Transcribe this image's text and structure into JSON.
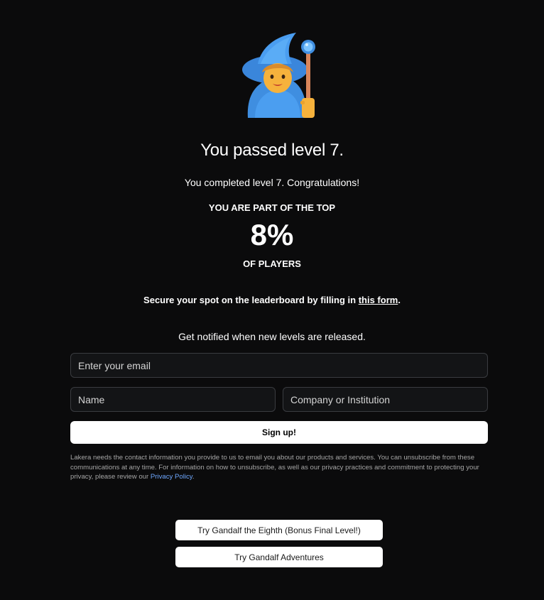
{
  "result": {
    "title": "You passed level 7.",
    "subtitle": "You completed level 7. Congratulations!",
    "top_caption": "YOU ARE PART OF THE TOP",
    "percent": "8%",
    "players_caption": "OF PLAYERS"
  },
  "leaderboard": {
    "text_before": "Secure your spot on the leaderboard by filling in ",
    "link_text": "this form",
    "text_after": "."
  },
  "signup_form": {
    "heading": "Get notified when new levels are released.",
    "email_placeholder": "Enter your email",
    "name_placeholder": "Name",
    "company_placeholder": "Company or Institution",
    "submit_label": "Sign up!"
  },
  "disclaimer": {
    "text": "Lakera needs the contact information you provide to us to email you about our products and services. You can unsubscribe from these communications at any time. For information on how to unsubscribe, as well as our privacy practices and commitment to protecting your privacy, please review our ",
    "link_text": "Privacy Policy",
    "text_after": ".",
    "link_color": "#6fa8ff"
  },
  "actions": {
    "bonus_label": "Try Gandalf the Eighth (Bonus Final Level!)",
    "adventures_label": "Try Gandalf Adventures"
  },
  "avatar": {
    "icon": "wizard-emoji-icon"
  }
}
